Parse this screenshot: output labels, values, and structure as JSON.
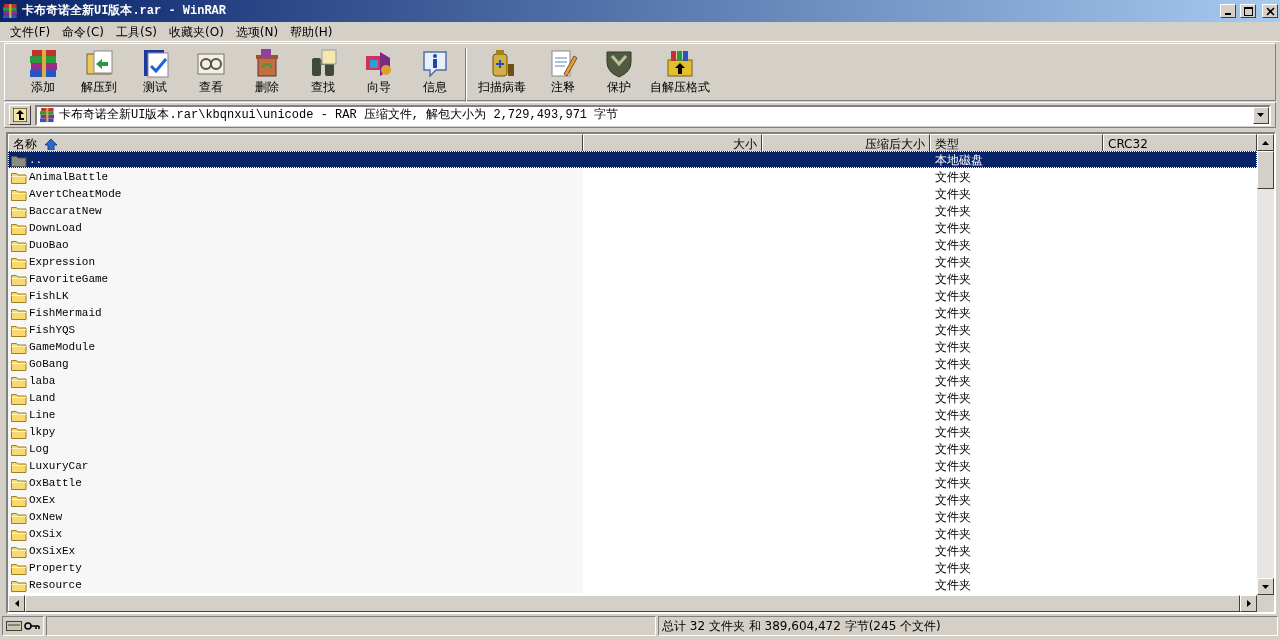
{
  "window": {
    "title": "卡布奇诺全新UI版本.rar - WinRAR"
  },
  "menu": [
    "文件(F)",
    "命令(C)",
    "工具(S)",
    "收藏夹(O)",
    "选项(N)",
    "帮助(H)"
  ],
  "toolbar": [
    [
      "添加",
      "解压到",
      "测试",
      "查看",
      "删除",
      "查找",
      "向导",
      "信息"
    ],
    [
      "扫描病毒",
      "注释",
      "保护",
      "自解压格式"
    ]
  ],
  "address": {
    "path": "卡布奇诺全新UI版本.rar\\kbqnxui\\unicode - RAR 压缩文件, 解包大小为 2,729,493,971 字节"
  },
  "table": {
    "columns": [
      {
        "label": "名称",
        "sorted": true
      },
      {
        "label": "大小",
        "sorted": false
      },
      {
        "label": "压缩后大小",
        "sorted": false
      },
      {
        "label": "类型",
        "sorted": false
      },
      {
        "label": "CRC32",
        "sorted": false
      }
    ],
    "rows": [
      {
        "name": "..",
        "type": "本地磁盘",
        "kind": "parent",
        "selected": true
      },
      {
        "name": "AnimalBattle",
        "type": "文件夹",
        "kind": "folder",
        "selected": false
      },
      {
        "name": "AvertCheatMode",
        "type": "文件夹",
        "kind": "folder",
        "selected": false
      },
      {
        "name": "BaccaratNew",
        "type": "文件夹",
        "kind": "folder",
        "selected": false
      },
      {
        "name": "DownLoad",
        "type": "文件夹",
        "kind": "folder",
        "selected": false
      },
      {
        "name": "DuoBao",
        "type": "文件夹",
        "kind": "folder",
        "selected": false
      },
      {
        "name": "Expression",
        "type": "文件夹",
        "kind": "folder",
        "selected": false
      },
      {
        "name": "FavoriteGame",
        "type": "文件夹",
        "kind": "folder",
        "selected": false
      },
      {
        "name": "FishLK",
        "type": "文件夹",
        "kind": "folder",
        "selected": false
      },
      {
        "name": "FishMermaid",
        "type": "文件夹",
        "kind": "folder",
        "selected": false
      },
      {
        "name": "FishYQS",
        "type": "文件夹",
        "kind": "folder",
        "selected": false
      },
      {
        "name": "GameModule",
        "type": "文件夹",
        "kind": "folder",
        "selected": false
      },
      {
        "name": "GoBang",
        "type": "文件夹",
        "kind": "folder",
        "selected": false
      },
      {
        "name": "laba",
        "type": "文件夹",
        "kind": "folder",
        "selected": false
      },
      {
        "name": "Land",
        "type": "文件夹",
        "kind": "folder",
        "selected": false
      },
      {
        "name": "Line",
        "type": "文件夹",
        "kind": "folder",
        "selected": false
      },
      {
        "name": "lkpy",
        "type": "文件夹",
        "kind": "folder",
        "selected": false
      },
      {
        "name": "Log",
        "type": "文件夹",
        "kind": "folder",
        "selected": false
      },
      {
        "name": "LuxuryCar",
        "type": "文件夹",
        "kind": "folder",
        "selected": false
      },
      {
        "name": "OxBattle",
        "type": "文件夹",
        "kind": "folder",
        "selected": false
      },
      {
        "name": "OxEx",
        "type": "文件夹",
        "kind": "folder",
        "selected": false
      },
      {
        "name": "OxNew",
        "type": "文件夹",
        "kind": "folder",
        "selected": false
      },
      {
        "name": "OxSix",
        "type": "文件夹",
        "kind": "folder",
        "selected": false
      },
      {
        "name": "OxSixEx",
        "type": "文件夹",
        "kind": "folder",
        "selected": false
      },
      {
        "name": "Property",
        "type": "文件夹",
        "kind": "folder",
        "selected": false
      },
      {
        "name": "Resource",
        "type": "文件夹",
        "kind": "folder",
        "selected": false
      }
    ]
  },
  "status_bar": {
    "summary": "总计 32 文件夹 和 389,604,472 字节(245 个文件)"
  }
}
